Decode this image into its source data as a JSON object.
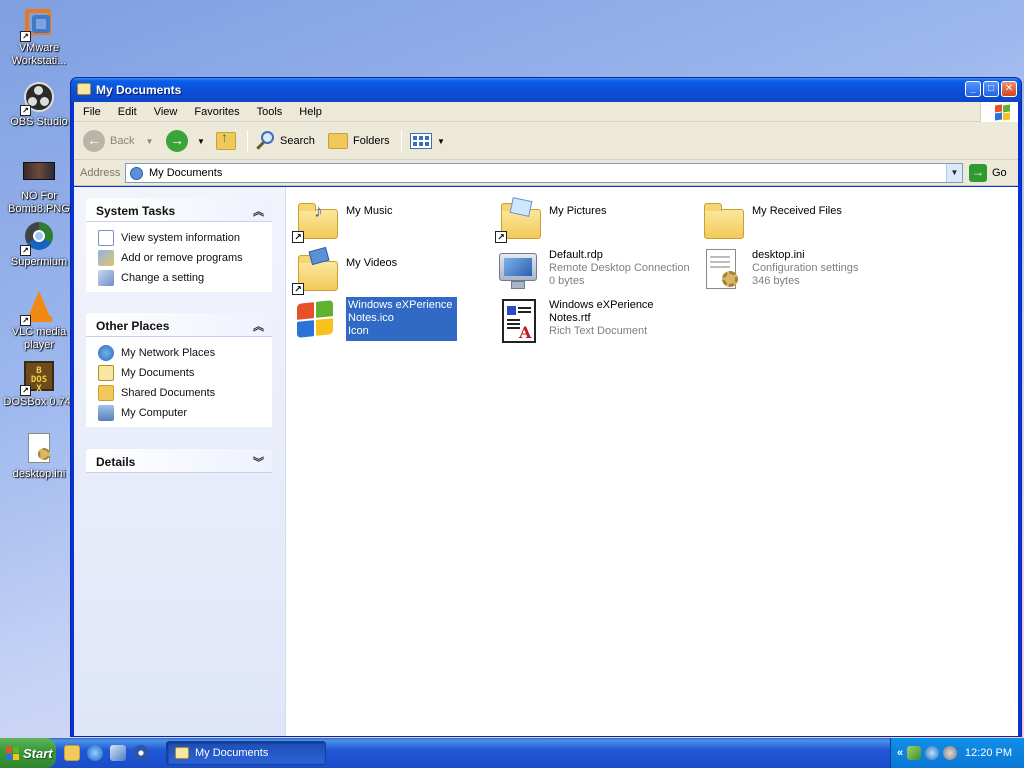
{
  "desktop": {
    "icons": [
      {
        "label": "VMware Workstati...",
        "icon": "vmware-icon"
      },
      {
        "label": "OBS Studio",
        "icon": "obs-icon"
      },
      {
        "label": "NO For Bomb8.PNG",
        "icon": "image-file-icon"
      },
      {
        "label": "Supermium",
        "icon": "supermium-icon"
      },
      {
        "label": "VLC media player",
        "icon": "vlc-icon"
      },
      {
        "label": "DOSBox 0.74-",
        "icon": "dosbox-icon"
      },
      {
        "label": "desktop.ini",
        "icon": "ini-file-icon"
      }
    ]
  },
  "window": {
    "title": "My Documents",
    "menu": [
      "File",
      "Edit",
      "View",
      "Favorites",
      "Tools",
      "Help"
    ],
    "toolbar": {
      "back": "Back",
      "search": "Search",
      "folders": "Folders"
    },
    "address": {
      "label": "Address",
      "value": "My Documents",
      "go": "Go"
    },
    "taskpane": {
      "system_tasks": {
        "title": "System Tasks",
        "items": [
          "View system information",
          "Add or remove programs",
          "Change a setting"
        ]
      },
      "other_places": {
        "title": "Other Places",
        "items": [
          "My Network Places",
          "My Documents",
          "Shared Documents",
          "My Computer"
        ]
      },
      "details": {
        "title": "Details"
      }
    },
    "files": [
      {
        "name": "My Music",
        "line2": "",
        "line3": "",
        "icon": "music-folder-icon"
      },
      {
        "name": "My Pictures",
        "line2": "",
        "line3": "",
        "icon": "pictures-folder-icon"
      },
      {
        "name": "My Received Files",
        "line2": "",
        "line3": "",
        "icon": "folder-icon"
      },
      {
        "name": "My Videos",
        "line2": "",
        "line3": "",
        "icon": "videos-folder-icon"
      },
      {
        "name": "Default.rdp",
        "line2": "Remote Desktop Connection",
        "line3": "0 bytes",
        "icon": "remote-desktop-icon"
      },
      {
        "name": "desktop.ini",
        "line2": "Configuration settings",
        "line3": "346 bytes",
        "icon": "config-file-icon"
      },
      {
        "name": "Windows eXPerience",
        "line2": "Notes.ico",
        "line3": "Icon",
        "icon": "windows-logo-icon",
        "selected": true
      },
      {
        "name": "Windows eXPerience",
        "line2": "Notes.rtf",
        "line3": "Rich Text Document",
        "icon": "rtf-document-icon"
      }
    ]
  },
  "taskbar": {
    "start": "Start",
    "task_button": "My Documents",
    "tray_chevron": "«",
    "clock": "12:20 PM"
  },
  "colors": {
    "titlebar": "#0b4fd6",
    "selection": "#316ac5",
    "start_green": "#3c9b3b",
    "taskbar_blue": "#2157d7"
  }
}
